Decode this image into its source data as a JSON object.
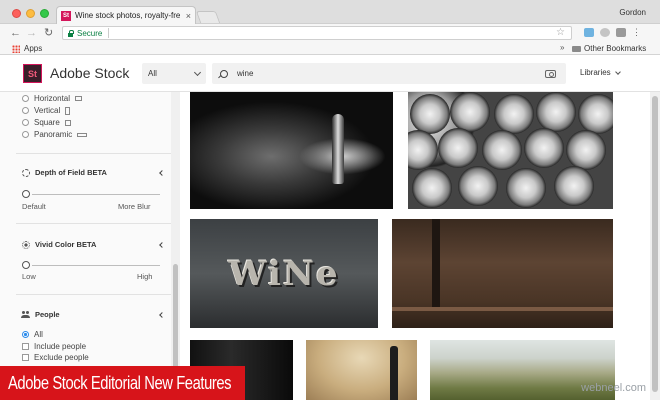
{
  "browser": {
    "tab_favicon": "St",
    "tab_title": "Wine stock photos, royalty-fre",
    "tab_close": "×",
    "profile": "Gordon",
    "secure_label": "Secure",
    "bookmarks": {
      "apps_label": "Apps",
      "overflow": "»",
      "other_label": "Other Bookmarks"
    }
  },
  "header": {
    "logo_text": "St",
    "brand": "Adobe Stock",
    "filter_value": "All",
    "search_query": "wine",
    "libraries_label": "Libraries"
  },
  "sidebar": {
    "orientation_options": [
      {
        "label": "Horizontal",
        "shape": "horizontal-icon",
        "checked": false
      },
      {
        "label": "Vertical",
        "shape": "vertical-icon",
        "checked": false
      },
      {
        "label": "Square",
        "shape": "square-icon",
        "checked": false
      },
      {
        "label": "Panoramic",
        "shape": "panoramic-icon",
        "checked": false
      }
    ],
    "depth_of_field": {
      "title": "Depth of Field BETA",
      "min_label": "Default",
      "max_label": "More Blur",
      "value": 0
    },
    "vivid_color": {
      "title": "Vivid Color BETA",
      "min_label": "Low",
      "max_label": "High",
      "value": 0
    },
    "people": {
      "title": "People",
      "options": [
        {
          "label": "All",
          "type": "radio",
          "checked": true
        },
        {
          "label": "Include people",
          "type": "checkbox",
          "checked": false
        },
        {
          "label": "Exclude people",
          "type": "checkbox",
          "checked": false
        }
      ]
    }
  },
  "results": {
    "images": [
      {
        "subject": "barrel and bottles, black and white"
      },
      {
        "subject": "stacked wine barrels"
      },
      {
        "subject": "wine letterpress text"
      },
      {
        "subject": "wooden barrel surface"
      },
      {
        "subject": "bottles dark"
      },
      {
        "subject": "single bottle on sepia"
      },
      {
        "subject": "vineyard landscape"
      }
    ],
    "letterpress_text": "WiNe"
  },
  "overlay": {
    "banner": "Adobe Stock Editorial New Features",
    "watermark": "webneel.com"
  },
  "colors": {
    "accent_red": "#d7141a",
    "secure_green": "#0b8043",
    "radio_blue": "#2d8ceb",
    "logo_bg": "#3a1e29"
  }
}
